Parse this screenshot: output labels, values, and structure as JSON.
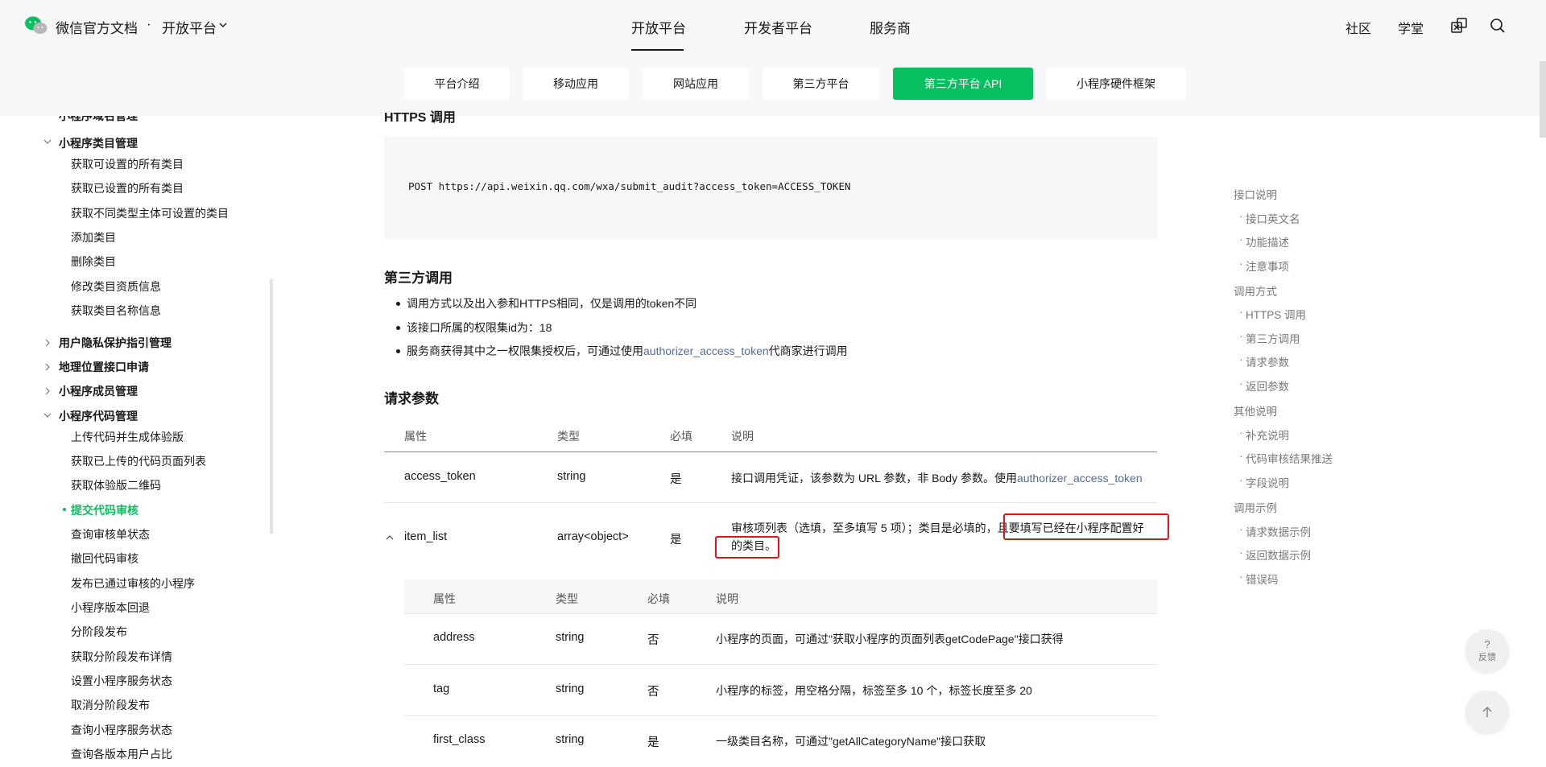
{
  "header": {
    "brand": "微信官方文档",
    "dot": "·",
    "platform": "开放平台",
    "nav": [
      "开放平台",
      "开发者平台",
      "服务商"
    ],
    "right_links": [
      "社区",
      "学堂"
    ]
  },
  "tabs": [
    "平台介绍",
    "移动应用",
    "网站应用",
    "第三方平台",
    "第三方平台 API",
    "小程序硬件框架"
  ],
  "sidebar": {
    "cut_top": "小程序域名管理",
    "group_category": "小程序类目管理",
    "category_items": [
      "获取可设置的所有类目",
      "获取已设置的所有类目",
      "获取不同类型主体可设置的类目",
      "添加类目",
      "删除类目",
      "修改类目资质信息",
      "获取类目名称信息"
    ],
    "group_privacy": "用户隐私保护指引管理",
    "group_location": "地理位置接口申请",
    "group_member": "小程序成员管理",
    "group_code": "小程序代码管理",
    "code_items": [
      "上传代码并生成体验版",
      "获取已上传的代码页面列表",
      "获取体验版二维码",
      "提交代码审核",
      "查询审核单状态",
      "撤回代码审核",
      "发布已通过审核的小程序",
      "小程序版本回退",
      "分阶段发布",
      "获取分阶段发布详情",
      "设置小程序服务状态",
      "取消分阶段发布",
      "查询小程序服务状态",
      "查询各版本用户占比"
    ]
  },
  "main": {
    "https_heading": "HTTPS 调用",
    "code": "POST https://api.weixin.qq.com/wxa/submit_audit?access_token=ACCESS_TOKEN",
    "third_heading": "第三方调用",
    "bullets": {
      "b1": "调用方式以及出入参和HTTPS相同，仅是调用的token不同",
      "b2": "该接口所属的权限集id为：18",
      "b3_pre": "服务商获得其中之一权限集授权后，可通过使用",
      "b3_link": "authorizer_access_token",
      "b3_post": "代商家进行调用"
    },
    "params_heading": "请求参数",
    "table_headers": [
      "属性",
      "类型",
      "必填",
      "说明"
    ],
    "rows": {
      "r1": {
        "name": "access_token",
        "type": "string",
        "required": "是",
        "desc_pre": "接口调用凭证，该参数为 URL 参数，非 Body 参数。使用",
        "desc_link": "authorizer_access_token"
      },
      "r2": {
        "name": "item_list",
        "type": "array<object>",
        "required": "是",
        "desc_line1": "审核项列表（选填，至多填写 5 项）；类目是必填的，且要填写已经在小程序配置好",
        "desc_line2": "的类目。"
      }
    },
    "nested_headers": [
      "属性",
      "类型",
      "必填",
      "说明"
    ],
    "nested_rows": [
      {
        "name": "address",
        "type": "string",
        "required": "否",
        "desc": "小程序的页面，可通过\"获取小程序的页面列表getCodePage\"接口获得"
      },
      {
        "name": "tag",
        "type": "string",
        "required": "否",
        "desc": "小程序的标签，用空格分隔，标签至多 10 个，标签长度至多 20"
      },
      {
        "name": "first_class",
        "type": "string",
        "required": "是",
        "desc": "一级类目名称，可通过\"getAllCategoryName\"接口获取"
      }
    ]
  },
  "toc": {
    "g1": "接口说明",
    "s1": "接口英文名",
    "s2": "功能描述",
    "s3": "注意事项",
    "g2": "调用方式",
    "s4": "HTTPS 调用",
    "s5": "第三方调用",
    "s6": "请求参数",
    "s7": "返回参数",
    "g3": "其他说明",
    "s8": "补充说明",
    "s9": "代码审核结果推送",
    "s10": "字段说明",
    "g4": "调用示例",
    "s11": "请求数据示例",
    "s12": "返回数据示例",
    "s13": "错误码"
  },
  "float": {
    "help_mark": "?",
    "feedback": "反馈"
  },
  "colors": {
    "accent": "#07c160",
    "link": "#576b95",
    "highlight": "#e01515"
  }
}
